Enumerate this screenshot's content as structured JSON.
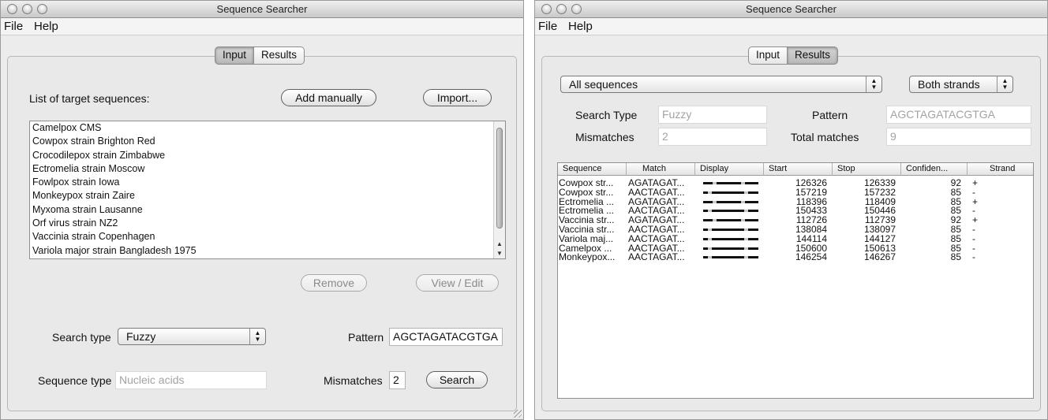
{
  "left": {
    "title": "Sequence Searcher",
    "menu": [
      "File",
      "Help"
    ],
    "tabs": [
      "Input",
      "Results"
    ],
    "active_tab": "Input",
    "targets_label": "List of target sequences:",
    "add_manually": "Add manually",
    "import": "Import...",
    "sequences": [
      "Camelpox CMS",
      "Cowpox strain Brighton Red",
      "Crocodilepox strain Zimbabwe",
      "Ectromelia strain Moscow",
      "Fowlpox strain Iowa",
      "Monkeypox strain Zaire",
      "Myxoma strain Lausanne",
      "Orf virus strain NZ2",
      "Vaccinia strain Copenhagen",
      "Variola major strain Bangladesh 1975"
    ],
    "remove": "Remove",
    "view_edit": "View / Edit",
    "search_type_label": "Search type",
    "search_type_value": "Fuzzy",
    "pattern_label": "Pattern",
    "pattern_value": "AGCTAGATACGTGA",
    "sequence_type_label": "Sequence type",
    "sequence_type_value": "Nucleic acids",
    "mismatches_label": "Mismatches",
    "mismatches_value": "2",
    "search": "Search"
  },
  "right": {
    "title": "Sequence Searcher",
    "menu": [
      "File",
      "Help"
    ],
    "tabs": [
      "Input",
      "Results"
    ],
    "active_tab": "Results",
    "sequence_filter": "All sequences",
    "strand_filter": "Both strands",
    "search_type_label": "Search Type",
    "search_type_value": "Fuzzy",
    "pattern_label": "Pattern",
    "pattern_value": "AGCTAGATACGTGA",
    "mismatches_label": "Mismatches",
    "mismatches_value": "2",
    "total_matches_label": "Total matches",
    "total_matches_value": "9",
    "columns": [
      "Sequence",
      "Match",
      "Display",
      "Start",
      "Stop",
      "Confiden...",
      "Strand"
    ],
    "rows": [
      {
        "sequence": "Cowpox str...",
        "match": "AGATAGAT...",
        "start": "126326",
        "stop": "126339",
        "confidence": "92",
        "strand": "+"
      },
      {
        "sequence": "Cowpox str...",
        "match": "AACTAGAT...",
        "start": "157219",
        "stop": "157232",
        "confidence": "85",
        "strand": "-"
      },
      {
        "sequence": "Ectromelia ...",
        "match": "AGATAGAT...",
        "start": "118396",
        "stop": "118409",
        "confidence": "85",
        "strand": "+"
      },
      {
        "sequence": "Ectromelia ...",
        "match": "AACTAGAT...",
        "start": "150433",
        "stop": "150446",
        "confidence": "85",
        "strand": "-"
      },
      {
        "sequence": "Vaccinia str...",
        "match": "AGATAGAT...",
        "start": "112726",
        "stop": "112739",
        "confidence": "92",
        "strand": "+"
      },
      {
        "sequence": "Vaccinia str...",
        "match": "AACTAGAT...",
        "start": "138084",
        "stop": "138097",
        "confidence": "85",
        "strand": "-"
      },
      {
        "sequence": "Variola maj...",
        "match": "AACTAGAT...",
        "start": "144114",
        "stop": "144127",
        "confidence": "85",
        "strand": "-"
      },
      {
        "sequence": "Camelpox ...",
        "match": "AACTAGAT...",
        "start": "150600",
        "stop": "150613",
        "confidence": "85",
        "strand": "-"
      },
      {
        "sequence": "Monkeypox...",
        "match": "AACTAGAT...",
        "start": "146254",
        "stop": "146267",
        "confidence": "85",
        "strand": "-"
      }
    ]
  }
}
